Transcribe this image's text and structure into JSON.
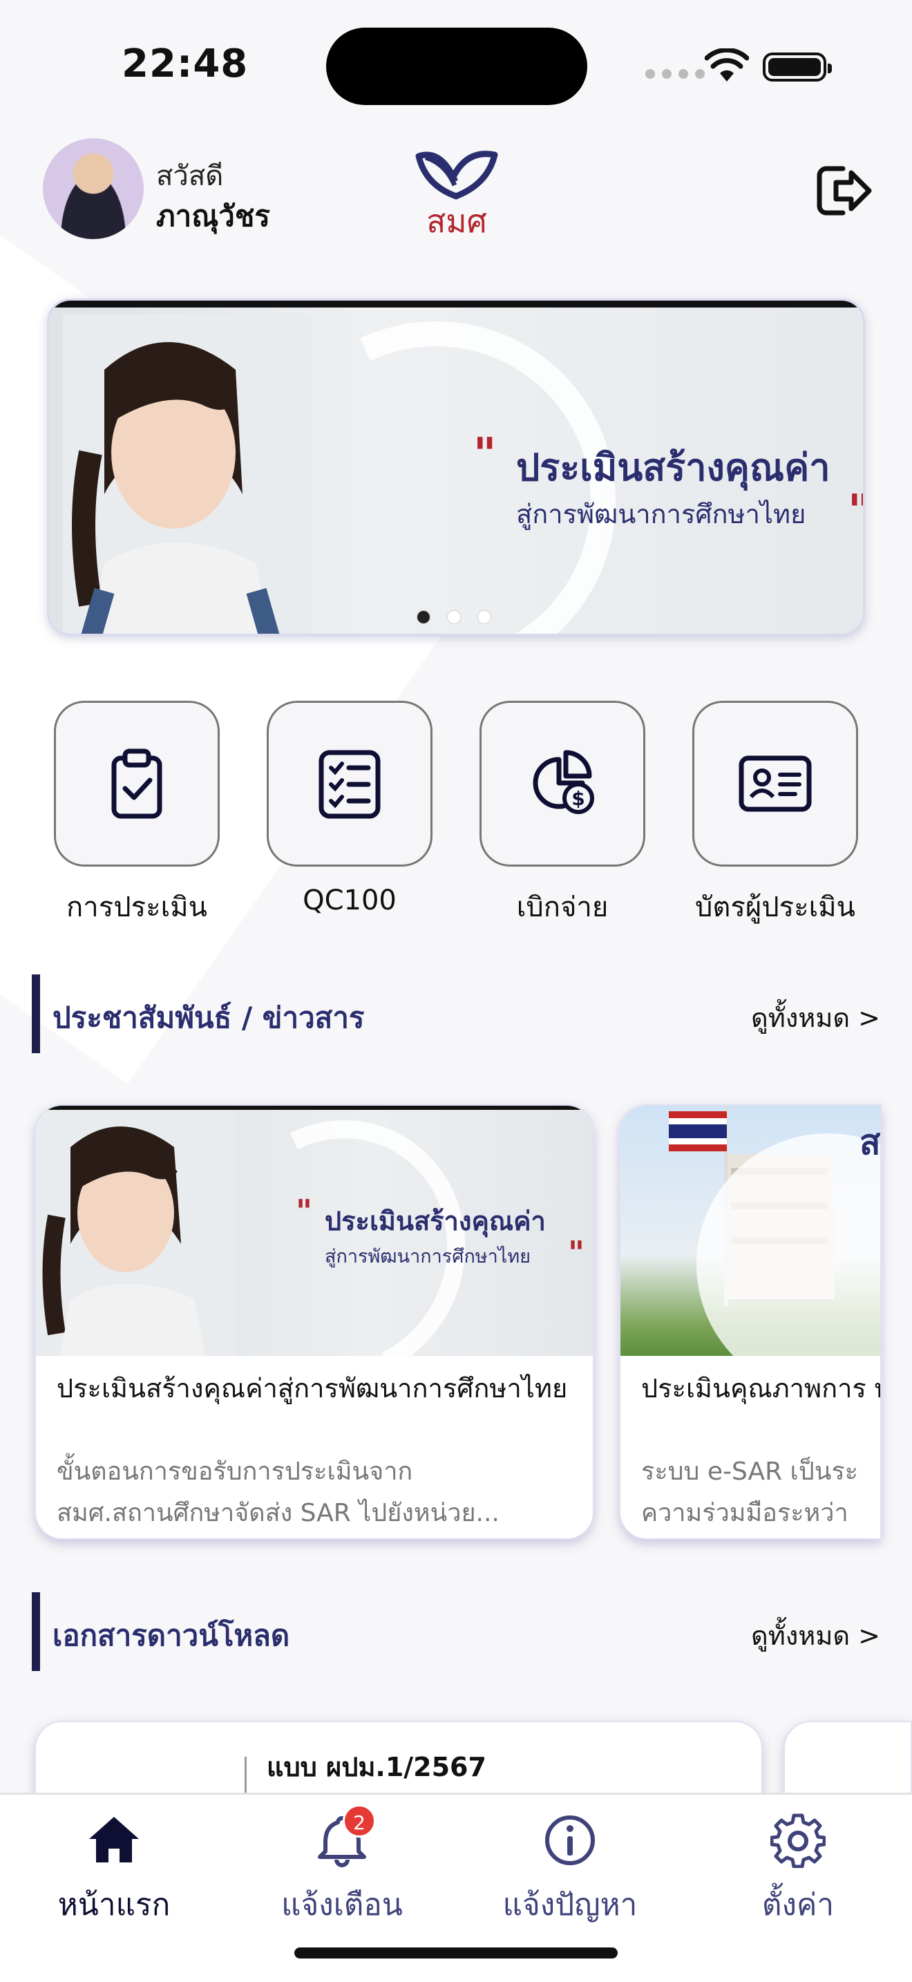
{
  "status_bar": {
    "time": "22:48"
  },
  "header": {
    "greeting": "สวัสดี",
    "user_name": "ภาณุวัชร",
    "logo_text": "สมศ"
  },
  "banner": {
    "headline": "ประเมินสร้างคุณค่า",
    "subline": "สู่การพัฒนาการศึกษาไทย",
    "page_count": 3,
    "active_page": 1
  },
  "menu": [
    {
      "label": "การประเมิน",
      "icon": "clipboard-check-icon"
    },
    {
      "label": "QC100",
      "icon": "checklist-icon"
    },
    {
      "label": "เบิกจ่าย",
      "icon": "pie-chart-money-icon"
    },
    {
      "label": "บัตรผู้ประเมิน",
      "icon": "id-card-icon"
    }
  ],
  "news_section": {
    "title": "ประชาสัมพันธ์ / ข่าวสาร",
    "see_all": "ดูทั้งหมด >",
    "cards": [
      {
        "img_headline": "ประเมินสร้างคุณค่า",
        "img_subline": "สู่การพัฒนาการศึกษาไทย",
        "title": "ประเมินสร้างคุณค่าสู่การพัฒนาการศึกษาไทย",
        "desc_line1": "ขั้นตอนการขอรับการประเมินจาก",
        "desc_line2": "สมศ.สถานศึกษาจัดส่ง SAR ไปยังหน่วย..."
      },
      {
        "title": "ประเมินคุณภาพการ พัฒนาการศึกษาไทย",
        "desc_line1": "ระบบ e-SAR เป็นระ",
        "desc_line2": "ความร่วมมือระหว่า"
      }
    ]
  },
  "docs_section": {
    "title": "เอกสารดาวน์โหลด",
    "see_all": "ดูทั้งหมด >",
    "cards": [
      {
        "title": "แบบ ผปม.1/2567"
      }
    ]
  },
  "tabbar": {
    "items": [
      {
        "label": "หน้าแรก",
        "icon": "home-icon",
        "active": true
      },
      {
        "label": "แจ้งเตือน",
        "icon": "bell-icon",
        "badge": "2"
      },
      {
        "label": "แจ้งปัญหา",
        "icon": "info-icon"
      },
      {
        "label": "ตั้งค่า",
        "icon": "gear-icon"
      }
    ]
  },
  "colors": {
    "brand_navy": "#2b2e6e",
    "brand_red": "#b3262e",
    "badge_red": "#e53935"
  }
}
